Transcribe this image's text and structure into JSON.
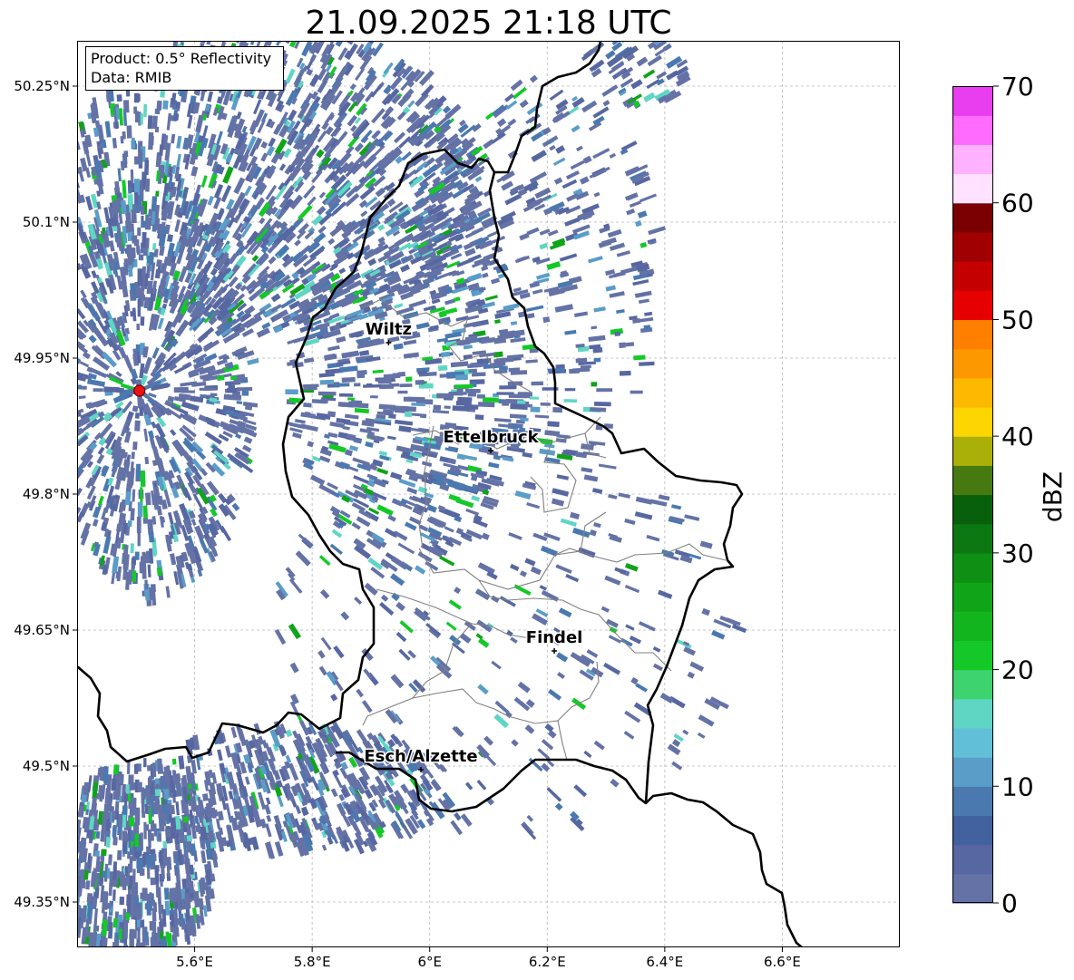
{
  "title": "21.09.2025 21:18 UTC",
  "info": {
    "product": "Product: 0.5° Reflectivity",
    "data": "Data: RMIB"
  },
  "axes": {
    "x_ticks": [
      {
        "value": 5.6,
        "label": "5.6°E"
      },
      {
        "value": 5.8,
        "label": "5.8°E"
      },
      {
        "value": 6.0,
        "label": "6°E"
      },
      {
        "value": 6.2,
        "label": "6.2°E"
      },
      {
        "value": 6.4,
        "label": "6.4°E"
      },
      {
        "value": 6.6,
        "label": "6.6°E"
      }
    ],
    "y_ticks": [
      {
        "value": 50.25,
        "label": "50.25°N"
      },
      {
        "value": 50.1,
        "label": "50.1°N"
      },
      {
        "value": 49.95,
        "label": "49.95°N"
      },
      {
        "value": 49.8,
        "label": "49.8°N"
      },
      {
        "value": 49.65,
        "label": "49.65°N"
      },
      {
        "value": 49.5,
        "label": "49.5°N"
      },
      {
        "value": 49.35,
        "label": "49.35°N"
      }
    ],
    "lon_range": [
      5.4,
      6.8
    ],
    "lat_range": [
      49.3,
      50.3
    ]
  },
  "cities": [
    {
      "name": "Wiltz",
      "lon": 5.93,
      "lat": 49.967
    },
    {
      "name": "Ettelbruck",
      "lon": 6.104,
      "lat": 49.848
    },
    {
      "name": "Findel",
      "lon": 6.212,
      "lat": 49.627
    },
    {
      "name": "Esch/Alzette",
      "lon": 5.985,
      "lat": 49.496
    }
  ],
  "radar_site": {
    "lon": 5.506,
    "lat": 49.914,
    "color": "#ee1111"
  },
  "colorbar": {
    "label": "dBZ",
    "ticks": [
      "0",
      "10",
      "20",
      "30",
      "40",
      "50",
      "60",
      "70"
    ],
    "min": 0,
    "max": 70,
    "step": 2.5,
    "colors": [
      "#6472a6",
      "#5767a1",
      "#42619f",
      "#4a79b0",
      "#5a9dc8",
      "#62bfd8",
      "#5fd6c4",
      "#3dd36e",
      "#14c927",
      "#12b51e",
      "#10a418",
      "#0f8f14",
      "#0c7812",
      "#08600d",
      "#467a10",
      "#abb008",
      "#fdd500",
      "#fdb800",
      "#fe9800",
      "#ff7f00",
      "#e70001",
      "#c40001",
      "#a00001",
      "#7a0001",
      "#ffe2ff",
      "#ffb2ff",
      "#ff6aff",
      "#e93df0"
    ]
  },
  "colors": {
    "border": "#000000",
    "canton": "#808080",
    "grid": "#b8b8b8"
  }
}
